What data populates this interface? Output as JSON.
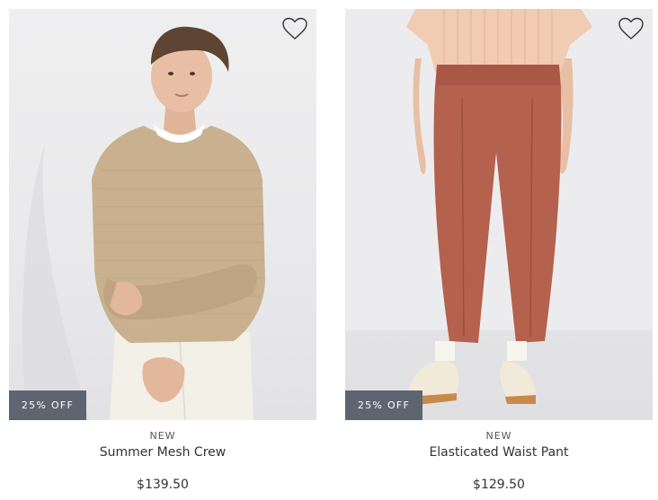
{
  "products": [
    {
      "tag": "NEW",
      "name": "Summer Mesh Crew",
      "price": "$139.50",
      "badge": "25% OFF",
      "image_alt": "Summer Mesh Crew sweater",
      "favorite_icon": "heart-outline-icon"
    },
    {
      "tag": "NEW",
      "name": "Elasticated Waist Pant",
      "price": "$129.50",
      "badge": "25% OFF",
      "image_alt": "Elasticated Waist Pant",
      "favorite_icon": "heart-outline-icon"
    }
  ],
  "colors": {
    "badge_bg": "#5d6570",
    "sweater": "#c9b18f",
    "pant": "#b4614d",
    "shirt": "#f1cbb2"
  }
}
